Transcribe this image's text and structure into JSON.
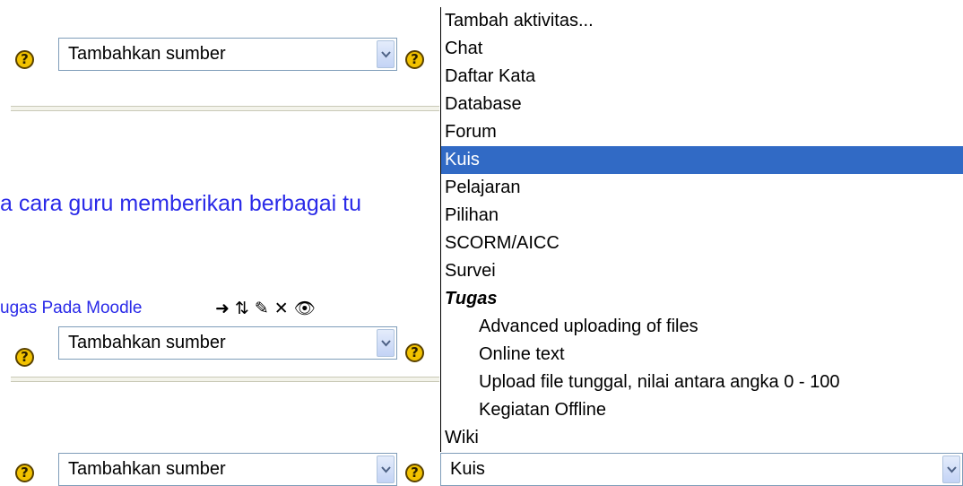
{
  "rows": [
    {
      "select_value": "Tambahkan sumber"
    },
    {
      "select_value": "Tambahkan sumber"
    },
    {
      "select_value": "Tambahkan sumber"
    }
  ],
  "help_symbol": "?",
  "section_heading": "a cara guru memberikan berbagai tu",
  "topic_link": "ugas Pada Moodle",
  "tool_icons": [
    "move-arrow-icon",
    "move-updown-icon",
    "edit-icon",
    "delete-icon",
    "show-eye-icon"
  ],
  "activity_select": {
    "value": "Kuis",
    "options": [
      {
        "label": "Tambah aktivitas...",
        "type": "option"
      },
      {
        "label": "Chat",
        "type": "option"
      },
      {
        "label": "Daftar Kata",
        "type": "option"
      },
      {
        "label": "Database",
        "type": "option"
      },
      {
        "label": "Forum",
        "type": "option"
      },
      {
        "label": "Kuis",
        "type": "option",
        "selected": true
      },
      {
        "label": "Pelajaran",
        "type": "option"
      },
      {
        "label": "Pilihan",
        "type": "option"
      },
      {
        "label": "SCORM/AICC",
        "type": "option"
      },
      {
        "label": "Survei",
        "type": "option"
      },
      {
        "label": "Tugas",
        "type": "group"
      },
      {
        "label": "Advanced uploading of files",
        "type": "sub"
      },
      {
        "label": "Online text",
        "type": "sub"
      },
      {
        "label": "Upload file tunggal, nilai antara angka 0 - 100",
        "type": "sub"
      },
      {
        "label": "Kegiatan Offline",
        "type": "sub"
      },
      {
        "label": "Wiki",
        "type": "option"
      }
    ]
  },
  "colors": {
    "link": "#2a2ae8",
    "highlight": "#316ac5",
    "help_icon": "#f2c200"
  }
}
